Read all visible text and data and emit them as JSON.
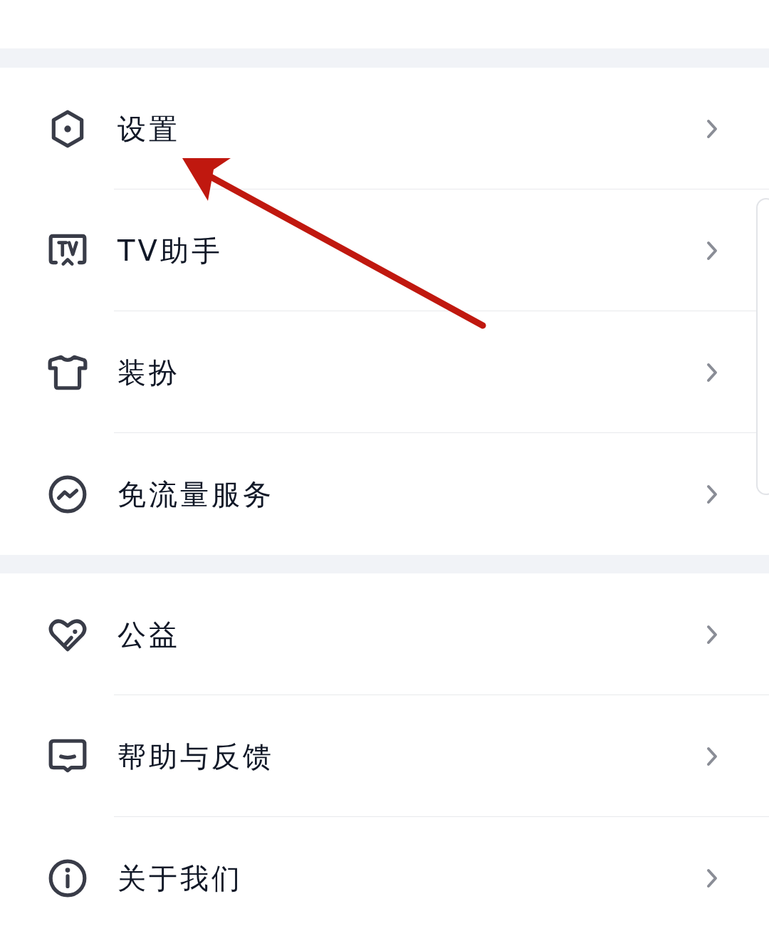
{
  "groups": [
    {
      "items": [
        {
          "kind": "settings",
          "label": "设置"
        },
        {
          "kind": "tv",
          "label": "TV助手"
        },
        {
          "kind": "shirt",
          "label": "装扮"
        },
        {
          "kind": "wave",
          "label": "免流量服务"
        }
      ]
    },
    {
      "items": [
        {
          "kind": "heart",
          "label": "公益"
        },
        {
          "kind": "message",
          "label": "帮助与反馈"
        },
        {
          "kind": "info",
          "label": "关于我们"
        }
      ]
    }
  ],
  "annotations": [
    {
      "kind": "arrow"
    }
  ]
}
